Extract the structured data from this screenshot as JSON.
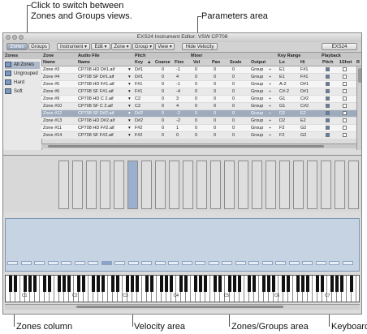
{
  "callouts": {
    "switch_views": "Click to switch between\nZones and Groups views.",
    "parameters_area": "Parameters area",
    "zones_column": "Zones column",
    "velocity_area": "Velocity area",
    "zones_groups_area": "Zones/Groups area",
    "keyboard": "Keyboard"
  },
  "window": {
    "title": "EXS24 Instrument Editor: VSW CP708",
    "toolbar": {
      "zones": "Zones",
      "groups": "Groups",
      "instrument": "Instrument ▾",
      "edit": "Edit ▾",
      "zone": "Zone ▾",
      "group": "Group ▾",
      "view": "View ▾",
      "hide_velocity": "Hide Velocity",
      "exs24": "EXS24"
    }
  },
  "header_groups": {
    "zones": "Zones",
    "zone": "Zone",
    "audio_file": "Audio File",
    "pitch": "Pitch",
    "mixer": "Mixer",
    "key_range": "Key Range",
    "playback": "Playback"
  },
  "columns": {
    "name": "Name",
    "file": "Name",
    "key": "Key",
    "coarse": "Coarse",
    "fine": "Fine",
    "vol": "Vol",
    "pan": "Pan",
    "scale": "Scale",
    "output": "Output",
    "lo": "Lo",
    "hi": "Hi",
    "pitch": "Pitch",
    "oneshot": "1Shot",
    "r": "R"
  },
  "groups": [
    "All Zones",
    "Ungrouped",
    "Hard",
    "Soft"
  ],
  "rows": [
    {
      "zone": "Zone #3",
      "file": "CP708 HD D#1.aif",
      "key": "D#1",
      "coarse": "0",
      "fine": "-1",
      "vol": "0",
      "pan": "0",
      "scale": "0",
      "output": "Group",
      "lo": "E1",
      "hi": "F#1"
    },
    {
      "zone": "Zone #4",
      "file": "CP708 SF D#1.aif",
      "key": "D#1",
      "coarse": "0",
      "fine": "4",
      "vol": "0",
      "pan": "0",
      "scale": "0",
      "output": "Group",
      "lo": "E1",
      "hi": "F#1"
    },
    {
      "zone": "Zone #5",
      "file": "CP708 HD F#1.aif",
      "key": "F#1",
      "coarse": "0",
      "fine": "-1",
      "vol": "0",
      "pan": "0",
      "scale": "0",
      "output": "Group",
      "lo": "A-2",
      "hi": "D#1"
    },
    {
      "zone": "Zone #6",
      "file": "CP708 SF F#1.aif",
      "key": "F#1",
      "coarse": "0",
      "fine": "-4",
      "vol": "0",
      "pan": "0",
      "scale": "0",
      "output": "Group",
      "lo": "C#-2",
      "hi": "D#1"
    },
    {
      "zone": "Zone #9",
      "file": "CP708 HD C 2.aif",
      "key": "C2",
      "coarse": "0",
      "fine": "3",
      "vol": "0",
      "pan": "0",
      "scale": "0",
      "output": "Group",
      "lo": "G1",
      "hi": "C#2"
    },
    {
      "zone": "Zone #10",
      "file": "CP708 SF C 2.aif",
      "key": "C2",
      "coarse": "0",
      "fine": "4",
      "vol": "0",
      "pan": "0",
      "scale": "0",
      "output": "Group",
      "lo": "G1",
      "hi": "C#2"
    },
    {
      "zone": "Zone #12",
      "file": "CP708 SF D#2.aif",
      "key": "D#2",
      "coarse": "0",
      "fine": "-2",
      "vol": "0",
      "pan": "0",
      "scale": "0",
      "output": "Group",
      "lo": "D2",
      "hi": "E2"
    },
    {
      "zone": "Zone #13",
      "file": "CP708 HD D#2.aif",
      "key": "D#2",
      "coarse": "0",
      "fine": "-2",
      "vol": "0",
      "pan": "0",
      "scale": "0",
      "output": "Group",
      "lo": "D2",
      "hi": "E2"
    },
    {
      "zone": "Zone #11",
      "file": "CP708 HD F#2.aif",
      "key": "F#2",
      "coarse": "0",
      "fine": "1",
      "vol": "0",
      "pan": "0",
      "scale": "0",
      "output": "Group",
      "lo": "F2",
      "hi": "G2"
    },
    {
      "zone": "Zone #14",
      "file": "CP708 SF F#2.aif",
      "key": "F#2",
      "coarse": "0",
      "fine": "0",
      "vol": "0",
      "pan": "0",
      "scale": "0",
      "output": "Group",
      "lo": "F2",
      "hi": "G2"
    }
  ],
  "velocity": {
    "max_label": "100",
    "min_label": "1"
  },
  "octave_labels": [
    "C1",
    "C2",
    "C3",
    "C4",
    "C5",
    "C6",
    "C7"
  ]
}
